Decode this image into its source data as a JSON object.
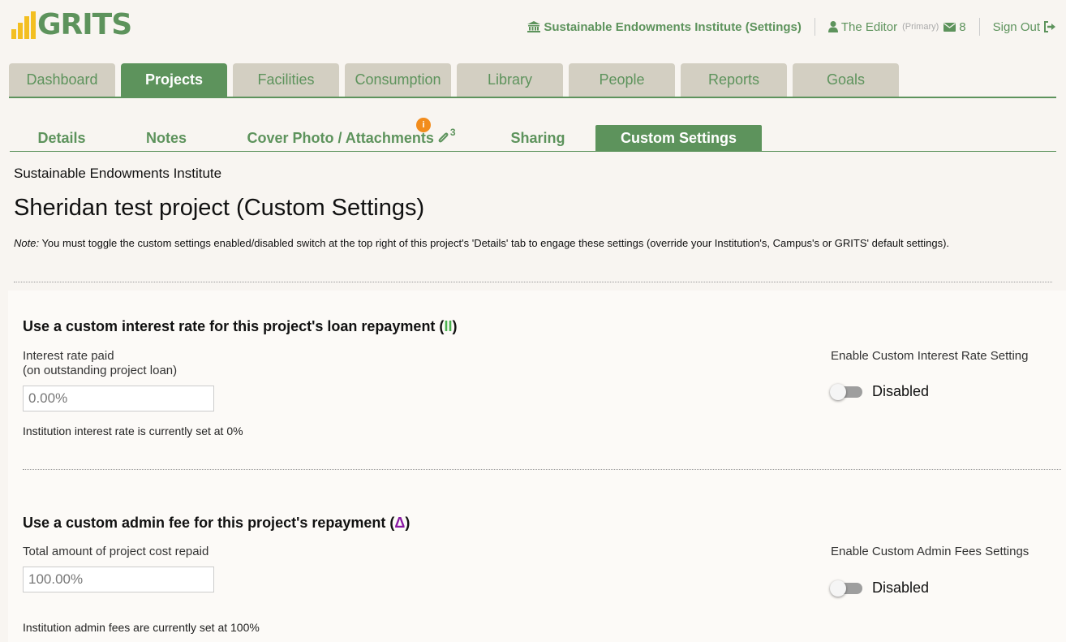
{
  "brand": {
    "name": "GRITS",
    "logo_color": "#5d935c",
    "bars_color": "#f3bf21"
  },
  "topbar": {
    "institution_link": "Sustainable Endowments Institute (Settings)",
    "user_name": "The Editor",
    "user_role": "(Primary)",
    "message_count": "8",
    "sign_out": "Sign Out",
    "icons": {
      "institution": "bank-icon",
      "user": "user-icon",
      "mail": "envelope-icon",
      "signout": "sign-out-icon"
    }
  },
  "main_tabs": [
    {
      "label": "Dashboard",
      "active": false
    },
    {
      "label": "Projects",
      "active": true
    },
    {
      "label": "Facilities",
      "active": false
    },
    {
      "label": "Consumption",
      "active": false
    },
    {
      "label": "Library",
      "active": false
    },
    {
      "label": "People",
      "active": false
    },
    {
      "label": "Reports",
      "active": false
    },
    {
      "label": "Goals",
      "active": false
    }
  ],
  "sub_tabs": {
    "details": "Details",
    "notes": "Notes",
    "attachments": "Cover Photo / Attachments",
    "attachments_count": "3",
    "attachments_badge": "i",
    "sharing": "Sharing",
    "custom_settings": "Custom Settings",
    "active": "custom_settings"
  },
  "page": {
    "institution": "Sustainable Endowments Institute",
    "title": "Sheridan test project (Custom Settings)",
    "note_label": "Note:",
    "note_text": " You must toggle the custom settings enabled/disabled switch at the top right of this project's 'Details' tab to engage these settings (override your Institution's, Campus's or GRITS' default settings)."
  },
  "interest_section": {
    "title": "Use a custom interest rate for this project's loan repayment (",
    "title_symbol": "II",
    "title_close": ")",
    "field_label_1": "Interest rate paid",
    "field_label_2": "(on outstanding project loan)",
    "field_value": "0.00%",
    "hint": "Institution interest rate is currently set at 0%",
    "toggle_label": "Enable Custom Interest Rate Setting",
    "toggle_state": "Disabled"
  },
  "admin_section": {
    "title": "Use a custom admin fee for this project's repayment (",
    "title_symbol": "Δ",
    "title_close": ")",
    "field_label": "Total amount of project cost repaid",
    "field_value": "100.00%",
    "hint": "Institution admin fees are currently set at 100%",
    "toggle_label": "Enable Custom Admin Fees Settings",
    "toggle_state": "Disabled"
  },
  "colors": {
    "accent": "#5d935c",
    "tab_inactive": "#d3cfc2",
    "badge": "#f28c1c",
    "background": "#f8f5f1"
  }
}
